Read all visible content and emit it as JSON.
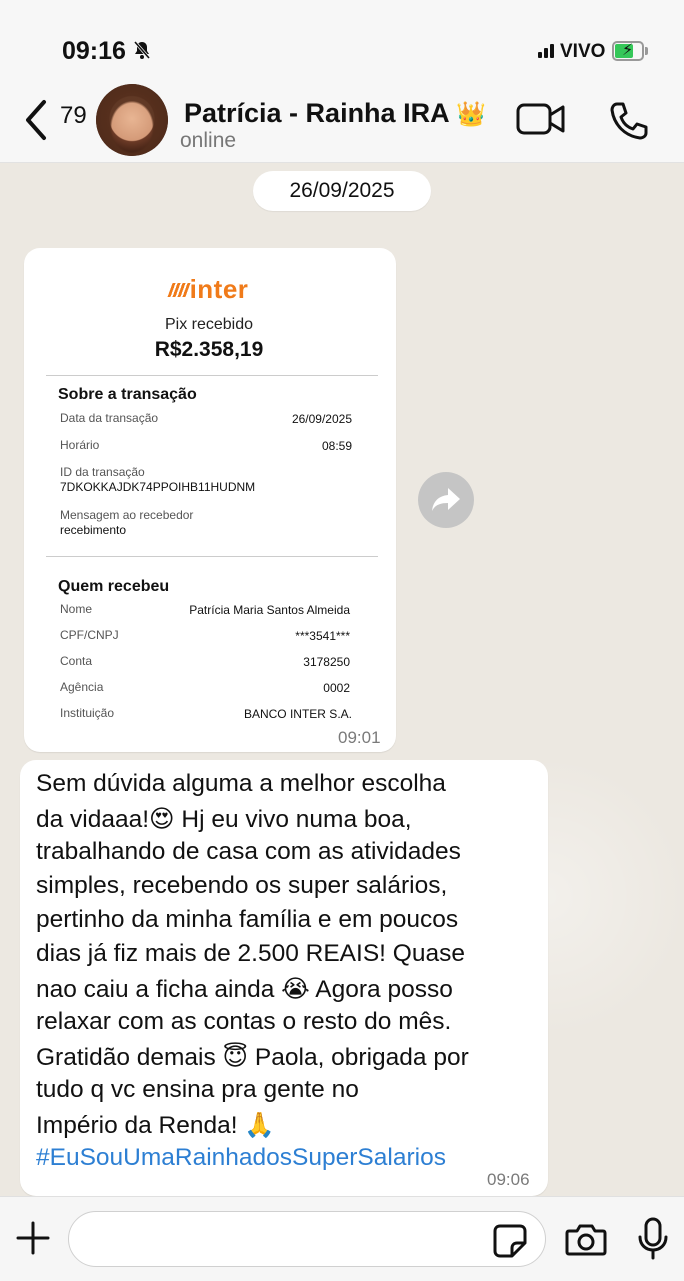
{
  "status_bar": {
    "time": "09:16",
    "carrier": "VIVO",
    "battery_level": 0.7
  },
  "header": {
    "back_count": "79",
    "contact_name": "Patrícia - Rainha IRA",
    "crown_emoji": "👑",
    "contact_status": "online",
    "icons": [
      "back-chevron-icon",
      "video-call-icon",
      "phone-call-icon"
    ]
  },
  "date_chip": "26/09/2025",
  "receipt_message": {
    "time": "09:01",
    "receipt": {
      "brand": "inter",
      "title": "Pix recebido",
      "amount": "R$2.358,19",
      "section_transaction": "Sobre a transação",
      "fields_transaction": {
        "date_label": "Data da transação",
        "date_value": "26/09/2025",
        "time_label": "Horário",
        "time_value": "08:59",
        "id_label": "ID da transação",
        "id_value": "7DKOKKAJDK74PPOIHB11HUDNM",
        "message_label": "Mensagem ao recebedor",
        "message_value": "recebimento"
      },
      "section_receiver": "Quem recebeu",
      "fields_receiver": {
        "name_label": "Nome",
        "name_value": "Patrícia Maria Santos Almeida",
        "doc_label": "CPF/CNPJ",
        "doc_value": "***3541***",
        "account_label": "Conta",
        "account_value": "3178250",
        "agency_label": "Agência",
        "agency_value": "0002",
        "institution_label": "Instituição",
        "institution_value": "BANCO INTER S.A."
      }
    }
  },
  "text_message": {
    "time": "09:06",
    "lines": [
      "Sem dúvida alguma a melhor escolha",
      "da vidaaa!😍 Hj eu vivo numa boa,",
      "trabalhando de casa com as atividades",
      "simples, recebendo os super salários,",
      "pertinho da minha família e em poucos",
      "dias já fiz mais de 2.500 REAIS! Quase",
      "nao caiu a ficha ainda 😭 Agora posso",
      "relaxar com as contas o resto do mês.",
      "Gratidão demais 😇 Paola, obrigada por",
      "tudo q vc ensina pra gente no",
      "Império da Renda! 🙏"
    ],
    "hashtag": "#EuSouUmaRainhadosSuperSalarios"
  },
  "input_bar": {
    "placeholder": "",
    "icons": [
      "plus-icon",
      "sticker-icon",
      "camera-icon",
      "microphone-icon"
    ]
  }
}
